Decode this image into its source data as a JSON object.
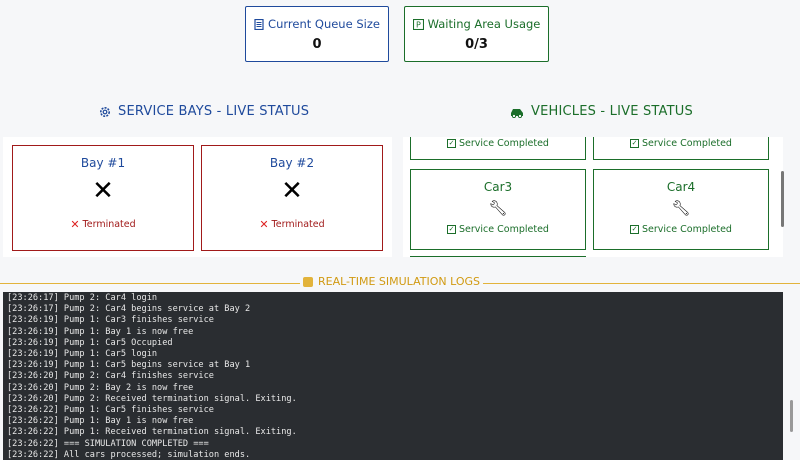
{
  "stats": {
    "queue": {
      "label": "Current Queue Size",
      "value": "0"
    },
    "waiting": {
      "label": "Waiting Area Usage",
      "value": "0/3"
    }
  },
  "bays": {
    "title": "SERVICE BAYS - LIVE STATUS",
    "items": [
      {
        "name": "Bay #1",
        "symbol": "✕",
        "status": "Terminated"
      },
      {
        "name": "Bay #2",
        "symbol": "✕",
        "status": "Terminated"
      }
    ]
  },
  "vehicles": {
    "title": "VEHICLES - LIVE STATUS",
    "items": [
      {
        "name": "",
        "status": "Service Completed"
      },
      {
        "name": "",
        "status": "Service Completed"
      },
      {
        "name": "Car3",
        "status": "Service Completed"
      },
      {
        "name": "Car4",
        "status": "Service Completed"
      }
    ]
  },
  "logs": {
    "title": "REAL-TIME SIMULATION LOGS",
    "lines": [
      "[23:26:17] Pump 2: Car4 login",
      "[23:26:17] Pump 2: Car4 begins service at Bay 2",
      "[23:26:19] Pump 1: Car3 finishes service",
      "[23:26:19] Pump 1: Bay 1 is now free",
      "[23:26:19] Pump 1: Car5 Occupied",
      "[23:26:19] Pump 1: Car5 login",
      "[23:26:19] Pump 1: Car5 begins service at Bay 1",
      "[23:26:20] Pump 2: Car4 finishes service",
      "[23:26:20] Pump 2: Bay 2 is now free",
      "[23:26:20] Pump 2: Received termination signal. Exiting.",
      "[23:26:22] Pump 1: Car5 finishes service",
      "[23:26:22] Pump 1: Bay 1 is now free",
      "[23:26:22] Pump 1: Received termination signal. Exiting.",
      "[23:26:22] === SIMULATION COMPLETED ===",
      "[23:26:22] All cars processed; simulation ends."
    ]
  }
}
